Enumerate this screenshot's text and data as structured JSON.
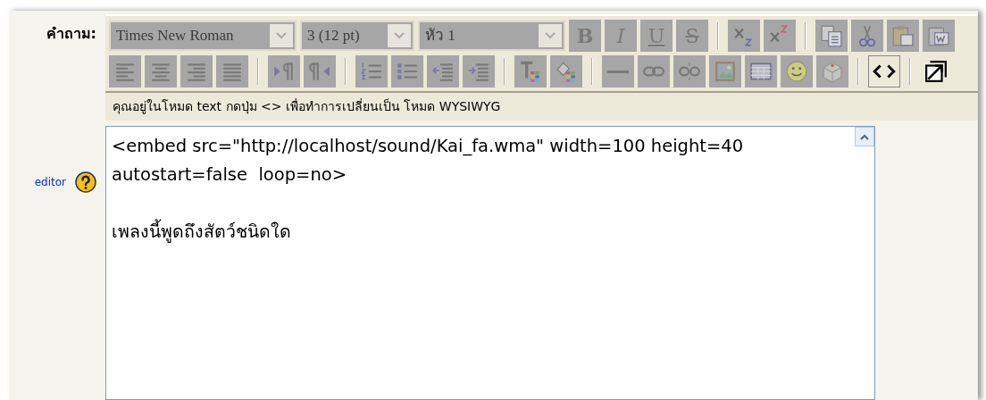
{
  "question_label": "คำถาม:",
  "help_link": "editor",
  "toolbar": {
    "rows": [
      [
        {
          "kind": "select",
          "value": "Times New Roman",
          "disabled": true,
          "selected": false
        },
        {
          "kind": "select",
          "value": "3 (12 pt)",
          "disabled": true,
          "selected": false
        },
        {
          "kind": "select",
          "value": "หัว 1",
          "disabled": true,
          "selected": false
        },
        {
          "kind": "bold",
          "label": "B",
          "disabled": true,
          "selected": false
        },
        {
          "kind": "italic",
          "label": "I",
          "disabled": true,
          "selected": false
        },
        {
          "kind": "underline",
          "label": "U",
          "disabled": true,
          "selected": false
        },
        {
          "kind": "strike",
          "label": "S",
          "disabled": true,
          "selected": false
        },
        {
          "kind": "separator"
        },
        {
          "kind": "subscript",
          "disabled": true,
          "selected": false
        },
        {
          "kind": "superscript",
          "disabled": true,
          "selected": false
        },
        {
          "kind": "separator"
        },
        {
          "kind": "copy",
          "disabled": true,
          "selected": false
        },
        {
          "kind": "cut",
          "disabled": true,
          "selected": false
        },
        {
          "kind": "paste",
          "disabled": true,
          "selected": false
        },
        {
          "kind": "paste-word",
          "disabled": true,
          "selected": false
        }
      ],
      [
        {
          "kind": "align-left",
          "disabled": true,
          "selected": false
        },
        {
          "kind": "align-center",
          "disabled": true,
          "selected": false
        },
        {
          "kind": "align-right",
          "disabled": true,
          "selected": false
        },
        {
          "kind": "justify",
          "disabled": true,
          "selected": false
        },
        {
          "kind": "separator"
        },
        {
          "kind": "ltr",
          "disabled": true,
          "selected": false
        },
        {
          "kind": "rtl",
          "disabled": true,
          "selected": false
        },
        {
          "kind": "separator"
        },
        {
          "kind": "ordered-list",
          "disabled": true,
          "selected": false
        },
        {
          "kind": "bullet-list",
          "disabled": true,
          "selected": false
        },
        {
          "kind": "outdent",
          "disabled": true,
          "selected": false
        },
        {
          "kind": "indent",
          "disabled": true,
          "selected": false
        },
        {
          "kind": "separator"
        },
        {
          "kind": "text-color",
          "disabled": true,
          "selected": false
        },
        {
          "kind": "highlight",
          "disabled": true,
          "selected": false
        },
        {
          "kind": "separator"
        },
        {
          "kind": "rule",
          "disabled": true,
          "selected": false
        },
        {
          "kind": "link",
          "disabled": true,
          "selected": false
        },
        {
          "kind": "unlink",
          "disabled": true,
          "selected": false
        },
        {
          "kind": "image",
          "disabled": true,
          "selected": false
        },
        {
          "kind": "table",
          "disabled": true,
          "selected": false
        },
        {
          "kind": "smiley",
          "disabled": true,
          "selected": false
        },
        {
          "kind": "special-char",
          "disabled": true,
          "selected": false
        },
        {
          "kind": "separator"
        },
        {
          "kind": "html-source",
          "disabled": false,
          "selected": true
        },
        {
          "kind": "separator"
        },
        {
          "kind": "fullscreen",
          "disabled": false,
          "selected": false
        }
      ]
    ]
  },
  "status_text": "คุณอยู่ในโหมด text กดปุ่ม <> เพื่อทำการเปลี่ยนเป็น โหมด WYSIWYG",
  "editor": {
    "value": "<embed src=\"http://localhost/sound/Kai_fa.wma\" width=100 height=40 autostart=false  loop=no>\n\nเพลงนี้พูดถึงสัตว์ชนิดใด"
  }
}
